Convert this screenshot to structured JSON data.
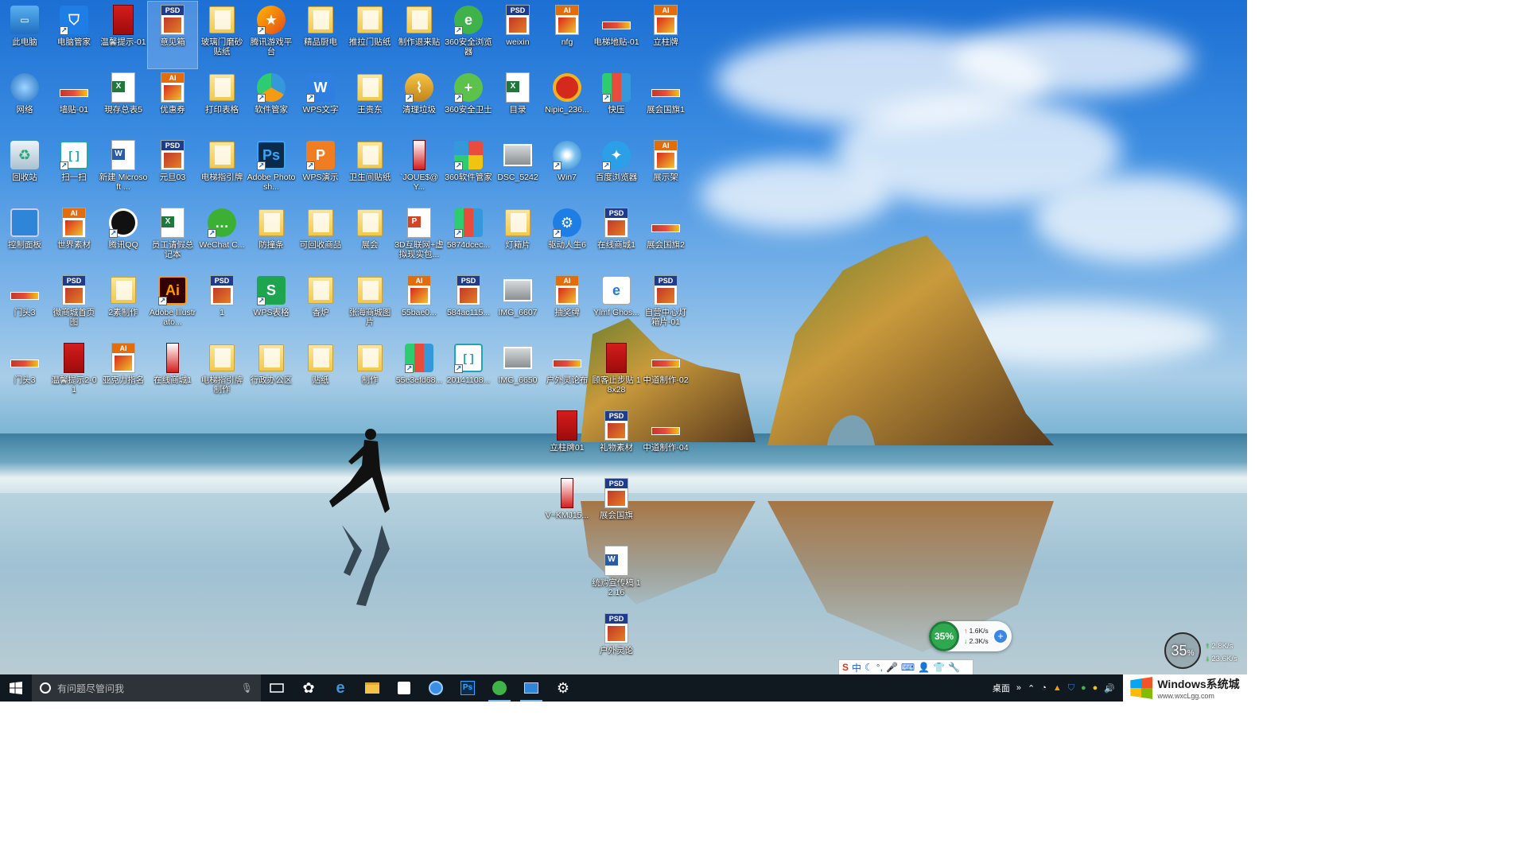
{
  "desktop": {
    "icons": [
      {
        "label": "此电脑",
        "kind": "computer",
        "col": 0,
        "row": 0
      },
      {
        "label": "电脑管家",
        "kind": "shield",
        "col": 1,
        "row": 0
      },
      {
        "label": "温馨提示-01",
        "kind": "red",
        "col": 2,
        "row": 0
      },
      {
        "label": "意见箱",
        "kind": "psd",
        "col": 3,
        "row": 0,
        "selected": true
      },
      {
        "label": "玻璃门磨砂贴纸",
        "kind": "folder",
        "col": 4,
        "row": 0
      },
      {
        "label": "腾讯游戏平台",
        "kind": "game",
        "col": 5,
        "row": 0
      },
      {
        "label": "精品厨电",
        "kind": "folder",
        "col": 6,
        "row": 0
      },
      {
        "label": "推拉门贴纸",
        "kind": "folder",
        "col": 7,
        "row": 0
      },
      {
        "label": "制作退来贴",
        "kind": "folder",
        "col": 8,
        "row": 0
      },
      {
        "label": "360安全浏览器",
        "kind": "360browser",
        "col": 9,
        "row": 0
      },
      {
        "label": "weixin",
        "kind": "psd",
        "col": 10,
        "row": 0
      },
      {
        "label": "nfg",
        "kind": "ai",
        "col": 11,
        "row": 0
      },
      {
        "label": "电梯地贴-01",
        "kind": "banner",
        "col": 12,
        "row": 0
      },
      {
        "label": "立柱牌",
        "kind": "ai",
        "col": 13,
        "row": 0
      },
      {
        "label": "网络",
        "kind": "network",
        "col": 0,
        "row": 1
      },
      {
        "label": "墙贴-01",
        "kind": "banner",
        "col": 1,
        "row": 1
      },
      {
        "label": "現存总表5",
        "kind": "excel",
        "col": 2,
        "row": 1
      },
      {
        "label": "优惠券",
        "kind": "ai",
        "col": 3,
        "row": 1
      },
      {
        "label": "打印表格",
        "kind": "folder",
        "col": 4,
        "row": 1
      },
      {
        "label": "软件管家",
        "kind": "softmgr",
        "col": 5,
        "row": 1
      },
      {
        "label": "WPS文字",
        "kind": "wpsw",
        "col": 6,
        "row": 1
      },
      {
        "label": "王贵东",
        "kind": "folder",
        "col": 7,
        "row": 1
      },
      {
        "label": "清理垃圾",
        "kind": "broom",
        "col": 8,
        "row": 1
      },
      {
        "label": "360安全卫士",
        "kind": "360guard",
        "col": 9,
        "row": 1
      },
      {
        "label": "目录",
        "kind": "excel",
        "col": 10,
        "row": 1
      },
      {
        "label": "Nipic_236...",
        "kind": "nipic",
        "col": 11,
        "row": 1
      },
      {
        "label": "快压",
        "kind": "kuaiya",
        "col": 12,
        "row": 1
      },
      {
        "label": "展会国旗1",
        "kind": "banner",
        "col": 13,
        "row": 1
      },
      {
        "label": "回收站",
        "kind": "recycle",
        "col": 0,
        "row": 2
      },
      {
        "label": "扫一扫",
        "kind": "scan",
        "col": 1,
        "row": 2
      },
      {
        "label": "新建 Microsoft ...",
        "kind": "word",
        "col": 2,
        "row": 2
      },
      {
        "label": "元旦03",
        "kind": "psd",
        "col": 3,
        "row": 2
      },
      {
        "label": "电梯指引牌",
        "kind": "folder",
        "col": 4,
        "row": 2
      },
      {
        "label": "Adobe Photosh...",
        "kind": "ps",
        "col": 5,
        "row": 2
      },
      {
        "label": "WPS演示",
        "kind": "wpsp",
        "col": 6,
        "row": 2
      },
      {
        "label": "卫生间贴纸",
        "kind": "folder",
        "col": 7,
        "row": 2
      },
      {
        "label": "`JOUE$@Y...",
        "kind": "vbanner",
        "col": 8,
        "row": 2
      },
      {
        "label": "360软件管家",
        "kind": "360soft",
        "col": 9,
        "row": 2
      },
      {
        "label": "DSC_5242",
        "kind": "photo",
        "col": 10,
        "row": 2
      },
      {
        "label": "Win7",
        "kind": "win7",
        "col": 11,
        "row": 2
      },
      {
        "label": "百度浏览器",
        "kind": "baidu",
        "col": 12,
        "row": 2
      },
      {
        "label": "展示架",
        "kind": "ai",
        "col": 13,
        "row": 2
      },
      {
        "label": "控制面板",
        "kind": "control",
        "col": 0,
        "row": 3
      },
      {
        "label": "世界素材",
        "kind": "ai",
        "col": 1,
        "row": 3
      },
      {
        "label": "腾讯QQ",
        "kind": "qq",
        "col": 2,
        "row": 3
      },
      {
        "label": "员工请假总记本",
        "kind": "excel",
        "col": 3,
        "row": 3
      },
      {
        "label": "WeChat C...",
        "kind": "wechat",
        "col": 4,
        "row": 3
      },
      {
        "label": "防撞条",
        "kind": "folder",
        "col": 5,
        "row": 3
      },
      {
        "label": "可回收商品",
        "kind": "folder",
        "col": 6,
        "row": 3
      },
      {
        "label": "展会",
        "kind": "folder",
        "col": 7,
        "row": 3
      },
      {
        "label": "3D互联网+虚拟现实包...",
        "kind": "ppt",
        "col": 8,
        "row": 3
      },
      {
        "label": "5874dcec...",
        "kind": "kuaiya",
        "col": 9,
        "row": 3
      },
      {
        "label": "灯箱片",
        "kind": "folder",
        "col": 10,
        "row": 3
      },
      {
        "label": "驱动人生6",
        "kind": "gear",
        "col": 11,
        "row": 3
      },
      {
        "label": "在线商城1",
        "kind": "psd",
        "col": 12,
        "row": 3
      },
      {
        "label": "展会国旗2",
        "kind": "banner",
        "col": 13,
        "row": 3
      },
      {
        "label": "门头3",
        "kind": "banner",
        "col": 0,
        "row": 4
      },
      {
        "label": "微商城首页图",
        "kind": "psd",
        "col": 1,
        "row": 4
      },
      {
        "label": "2素制作",
        "kind": "folder",
        "col": 2,
        "row": 4
      },
      {
        "label": "Adobe Illustrato...",
        "kind": "aiapp",
        "col": 3,
        "row": 4
      },
      {
        "label": "1",
        "kind": "psd",
        "col": 4,
        "row": 4
      },
      {
        "label": "WPS表格",
        "kind": "wpss",
        "col": 5,
        "row": 4
      },
      {
        "label": "香炉",
        "kind": "folder",
        "col": 6,
        "row": 4
      },
      {
        "label": "张海商城图片",
        "kind": "folder",
        "col": 7,
        "row": 4
      },
      {
        "label": "55bae0...",
        "kind": "ai",
        "col": 8,
        "row": 4
      },
      {
        "label": "584ac115...",
        "kind": "psd",
        "col": 9,
        "row": 4
      },
      {
        "label": "IMG_6607",
        "kind": "photo",
        "col": 10,
        "row": 4
      },
      {
        "label": "抽奖牌",
        "kind": "ai",
        "col": 11,
        "row": 4
      },
      {
        "label": "Ylmf Ghos...",
        "kind": "ie",
        "col": 12,
        "row": 4
      },
      {
        "label": "自营中心灯箱片-01",
        "kind": "psd",
        "col": 13,
        "row": 4
      },
      {
        "label": "门头3",
        "kind": "banner",
        "col": 0,
        "row": 5
      },
      {
        "label": "温馨提示2-01",
        "kind": "red",
        "col": 1,
        "row": 5
      },
      {
        "label": "亚克力指名",
        "kind": "ai",
        "col": 2,
        "row": 5
      },
      {
        "label": "在线商城1",
        "kind": "vbanner",
        "col": 3,
        "row": 5
      },
      {
        "label": "电梯指引牌制作",
        "kind": "folder",
        "col": 4,
        "row": 5
      },
      {
        "label": "行政办公区",
        "kind": "folder",
        "col": 5,
        "row": 5
      },
      {
        "label": "贴纸",
        "kind": "folder",
        "col": 6,
        "row": 5
      },
      {
        "label": "制作",
        "kind": "folder",
        "col": 7,
        "row": 5
      },
      {
        "label": "55e3efd68...",
        "kind": "kuaiya",
        "col": 8,
        "row": 5
      },
      {
        "label": "20141108...",
        "kind": "scan",
        "col": 9,
        "row": 5
      },
      {
        "label": "IMG_6650",
        "kind": "photo",
        "col": 10,
        "row": 5
      },
      {
        "label": "户外灵论布",
        "kind": "banner",
        "col": 11,
        "row": 5
      },
      {
        "label": "顾客止步贴 18x28",
        "kind": "red",
        "col": 12,
        "row": 5
      },
      {
        "label": "中道制作-02",
        "kind": "banner",
        "col": 13,
        "row": 5
      },
      {
        "label": "立柱牌01",
        "kind": "red",
        "col": 11,
        "row": 6
      },
      {
        "label": "礼物素材",
        "kind": "psd",
        "col": 12,
        "row": 6
      },
      {
        "label": "中道制作-04",
        "kind": "banner",
        "col": 13,
        "row": 6
      },
      {
        "label": "V~KMJ15...",
        "kind": "vbanner",
        "col": 11,
        "row": 7
      },
      {
        "label": "展会国旗",
        "kind": "psd",
        "col": 12,
        "row": 7
      },
      {
        "label": "统购宣传稿 12.16",
        "kind": "word",
        "col": 12,
        "row": 8
      },
      {
        "label": "户外灵论",
        "kind": "psd",
        "col": 12,
        "row": 9
      }
    ]
  },
  "net_widget": {
    "percent": "35%",
    "up": "1.6K/s",
    "down": "2.3K/s"
  },
  "speed_widget": {
    "percent": "35",
    "unit": "%",
    "up": "2.8K/s",
    "down": "23.6K/s"
  },
  "ime_bar": {
    "lang": "中"
  },
  "taskbar": {
    "search_placeholder": "有问题尽管问我",
    "apps": [
      "task-view",
      "cortana-app",
      "edge",
      "file-explorer",
      "store",
      "browser-360",
      "photoshop",
      "browser-360-green",
      "control-panel",
      "settings"
    ],
    "tray_label": "桌面",
    "tray_expand": "»",
    "clock_hidden": true
  },
  "brand": {
    "title": "Windows系统城",
    "url": "www.wxcLgg.com"
  }
}
